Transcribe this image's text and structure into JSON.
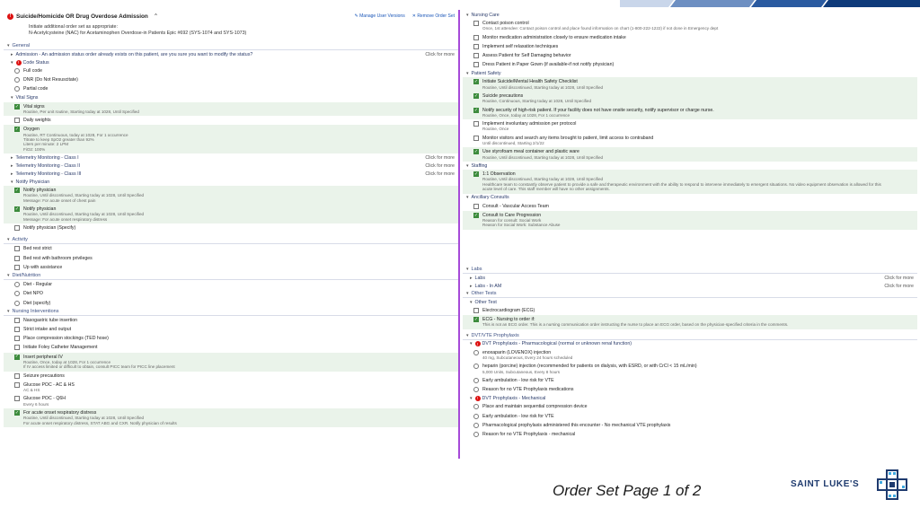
{
  "colors": {
    "accent": "#a64ad8",
    "checked_bg": "#eaf3ea",
    "brand": "#1e3a6e"
  },
  "header": {
    "title": "Suicide/Homicide OR Drug Overdose Admission",
    "manage_label": "Manage User Versions",
    "remove_label": "Remove Order Set",
    "note_line1": "Initiate additional order set as appropriate:",
    "note_line2": "N-Acetylcysteine (NAC) for Acetaminophen Overdose-in Patients Epic #692 (SYS-1074 and SYS-1073)"
  },
  "left": {
    "general": "General",
    "admission": "Admission - An admission status order already exists on this patient, are you sure you want to modify the status?",
    "click_more": "Click for more",
    "code_status": "Code Status",
    "full_code": "Full code",
    "dnr": "DNR (Do Not Resuscitate)",
    "partial": "Partial code",
    "vital_signs": "Vital Signs",
    "vitals_item": "Vital signs",
    "vitals_detail": "Routine, Per unit routine, Starting today at 1028, Until Specified",
    "daily_weights": "Daily weights",
    "oxygen": "Oxygen",
    "oxygen_d1": "Routine, RT Continuous, today at 1028, For 1 occurrence",
    "oxygen_d2": "Titrate to keep SpO2 greater than 92%",
    "oxygen_d3": "Liters per minute: 2 LPM",
    "oxygen_d4": "FiO2: 100%",
    "tele1": "Telemetry Monitoring - Class I",
    "tele2": "Telemetry Monitoring - Class II",
    "tele3": "Telemetry Monitoring - Class III",
    "notify": "Notify Physician",
    "notify1": "Notify physician",
    "notify1_d1": "Routine, Until discontinued, Starting today at 1028, Until Specified",
    "notify1_d2": "Message: For acute onset of chest pain",
    "notify2": "Notify physician",
    "notify2_d1": "Routine, Until discontinued, Starting today at 1028, Until Specified",
    "notify2_d2": "Message: For acute onset respiratory distress",
    "notify3": "Notify physician (Specify)",
    "activity": "Activity",
    "bedrest": "Bed rest strict",
    "bedrest_bath": "Bed rest with bathroom privileges",
    "up_assist": "Up with assistance",
    "diet": "Diet/Nutrition",
    "diet_regular": "Diet - Regular",
    "diet_npo": "Diet NPO",
    "diet_specify": "Diet (specify)",
    "nursing": "Nursing Interventions",
    "ng_tube": "Nasogastric tube insertion",
    "strict_io": "Strict intake and output",
    "ted": "Place compression stockings (TED hose)",
    "foley": "Initiate Foley Catheter Management",
    "iv": "Insert peripheral IV",
    "iv_d1": "Routine, Once, today at 1028, For 1 occurrence",
    "iv_d2": "If IV access limited or difficult to obtain, consult PICC team for PICC line placement",
    "seizure": "Seizure precautions",
    "glucose1": "Glucose POC - AC & HS",
    "glucose1_d": "AC & HS",
    "glucose2": "Glucose POC - Q6H",
    "glucose2_d": "Every 6 hours",
    "resp": "For acute onset respiratory distress",
    "resp_d1": "Routine, Until discontinued, Starting today at 1028, Until Specified",
    "resp_d2": "For acute onset respiratory distress, STAT ABG and CXR. Notify physician of results"
  },
  "right": {
    "nursing_care": "Nursing Care",
    "poison": "Contact poison control",
    "poison_d": "Once, 1st attendee: Contact poison control and place found information on chart (1-800-222-1222) if not done in Emergency dept",
    "med_admin": "Monitor medication administration closely to ensure medication intake",
    "relax": "Implement self relaxation techniques",
    "assess": "Assess Patient for Self Damaging behavior",
    "gown": "Dress Patient in Paper Gown (if available-if not notify physician)",
    "safety": "Patient Safety",
    "checklist": "Initiate Suicide/Mental Health Safety Checklist",
    "checklist_d": "Routine, Until discontinued, Starting today at 1028, Until Specified",
    "suicide_prec": "Suicide precautions",
    "suicide_prec_d": "Routine, Continuous, Starting today at 1028, Until Specified",
    "security": "Notify security of high-risk patient. If your facility does not have onsite security, notify supervisor or charge nurse.",
    "security_d": "Routine, Once, today at 1028, For 1 occurrence",
    "involuntary": "Implement involuntary admission per protocol",
    "involuntary_d": "Routine, Once",
    "search": "Monitor visitors and search any items brought to patient, limit access to contraband",
    "search_d": "Until discontinued, Starting 2/1/22",
    "styro": "Use styrofoam meal container and plastic ware",
    "styro_d": "Routine, Until discontinued, Starting today at 1028, Until Specified",
    "staffing": "Staffing",
    "observation": "1:1 Observation",
    "obs_d1": "Routine, Until discontinued, Starting today at 1028, Until Specified",
    "obs_d2": "Healthcare team to constantly observe patient to provide a safe and therapeutic environment with the ability to respond to intervene immediately to emergent situations. No video equipment observation is allowed for this",
    "obs_d3": "acute level of care. This staff member will have no other assignments.",
    "ancillary": "Ancillary Consults",
    "vascular": "Consult - Vascular Access Team",
    "care_prog": "Consult to Care Progression",
    "care_prog_d1": "Reason for consult: Social Work",
    "care_prog_d2": "Reason for Social Work: Substance Abuse",
    "labs": "Labs",
    "labs_sub": "Labs",
    "labs_am": "Labs - In AM",
    "click_more": "Click for more",
    "other_tests": "Other Tests",
    "other_test": "Other Test",
    "ecg": "Electrocardiogram (ECG)",
    "ecg_nurse": "ECG - Nursing to order if:",
    "ecg_nurse_d": "This is not an ECG order. This is a nursing communication order instructing the nurse to place an ECG order, based on the physician-specified criteria in the comments.",
    "dvt": "DVT/VTE Prophylaxis",
    "dvt_pharm": "DVT Prophylaxis - Pharmacological (normal or unknown renal function)",
    "enox": "enoxaparin (LOVENOX) injection",
    "enox_d": "40 mg, Subcutaneous, Every 24 hours scheduled",
    "heparin": "heparin (porcine) injection (recommended for patients on dialysis, with ESRD, or with CrCl < 15 mL/min)",
    "heparin_d": "5,000 Units, Subcutaneous, Every 8 hours",
    "ambulation1": "Early ambulation - low risk for VTE",
    "no_vte1": "Reason for no VTE Prophylaxis medications",
    "dvt_mech": "DVT Prophylaxis - Mechanical",
    "scd": "Place and maintain sequential compression device",
    "ambulation2": "Early ambulation - low risk for VTE",
    "pharm_given": "Pharmacological prophylaxis administered this encounter - No mechanical VTE prophylaxis",
    "no_vte2": "Reason for no VTE Prophylaxis - mechanical"
  },
  "footer": {
    "page_title": "Order Set Page 1 of 2",
    "brand": "SAINT LUKE'S"
  }
}
